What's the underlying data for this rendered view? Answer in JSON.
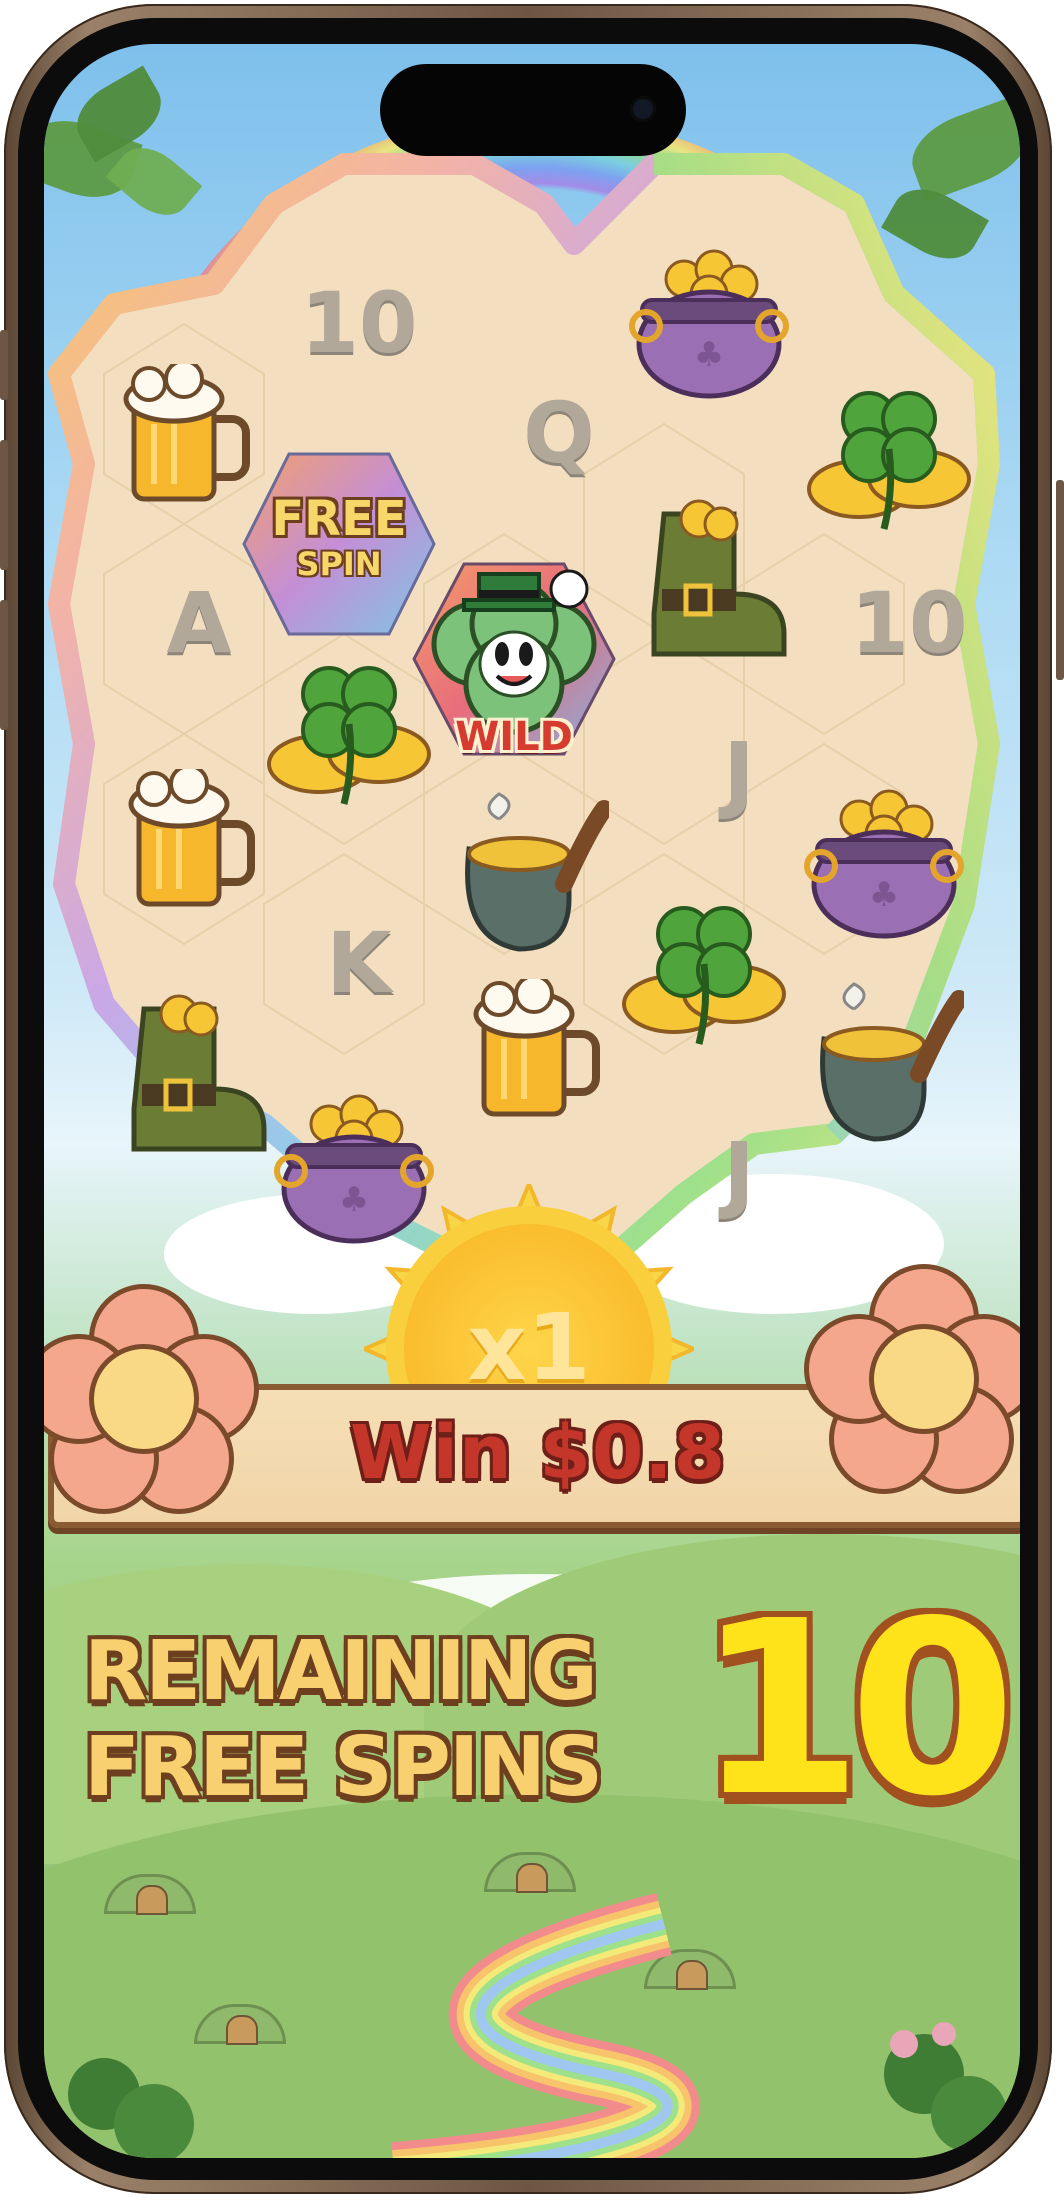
{
  "game": {
    "win_label": "Win $0.8",
    "multiplier": "x1",
    "remaining_label_line1": "REMAINING",
    "remaining_label_line2": "FREE SPINS",
    "remaining_count": "10"
  },
  "symbols": {
    "letter_10": "10",
    "letter_q": "Q",
    "letter_a": "A",
    "letter_j": "J",
    "letter_k": "K",
    "free_spin_line1": "FREE",
    "free_spin_line2": "SPIN",
    "wild_label": "WILD"
  },
  "icons": [
    "beer-mug-icon",
    "pot-of-gold-icon",
    "clover-coins-icon",
    "leprechaun-boot-icon",
    "smoking-pipe-icon",
    "free-spin-badge-icon",
    "wild-clover-mascot-icon",
    "flower-icon",
    "sun-icon"
  ],
  "colors": {
    "win_text": "#c4362a",
    "remaining_text": "#f8d070",
    "remaining_count": "#ffe31a",
    "board_fill": "#f3dfc0",
    "phone_frame": "#6d5744"
  }
}
